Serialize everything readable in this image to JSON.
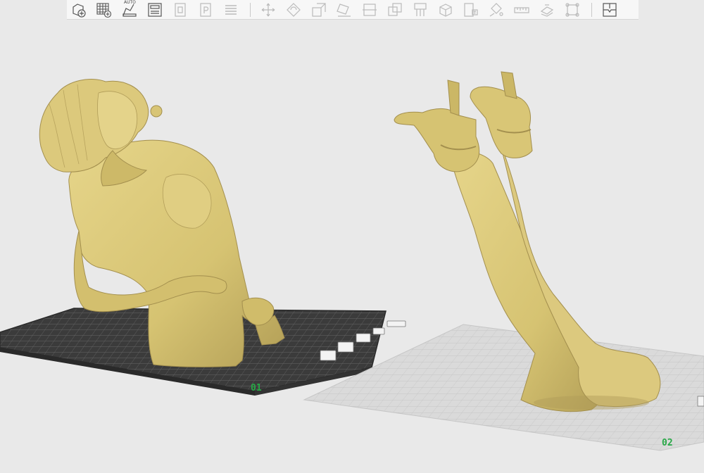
{
  "toolbar": {
    "buttons": [
      {
        "name": "add-plate-icon",
        "group": "plate"
      },
      {
        "name": "grid-layout-icon",
        "group": "plate"
      },
      {
        "name": "auto-arrange-icon",
        "group": "plate",
        "label": "AUTO"
      },
      {
        "name": "plate-settings-icon",
        "group": "plate"
      },
      {
        "name": "orient-icon",
        "group": "plate-disabled"
      },
      {
        "name": "plate-p-icon",
        "group": "plate-disabled"
      },
      {
        "name": "layers-icon",
        "group": "plate-disabled"
      },
      {
        "name": "move-icon",
        "group": "edit"
      },
      {
        "name": "rotate-icon",
        "group": "edit"
      },
      {
        "name": "scale-icon",
        "group": "edit"
      },
      {
        "name": "lay-on-face-icon",
        "group": "edit"
      },
      {
        "name": "cut-icon",
        "group": "edit"
      },
      {
        "name": "boolean-icon",
        "group": "edit"
      },
      {
        "name": "supports-icon",
        "group": "edit"
      },
      {
        "name": "box-icon",
        "group": "edit"
      },
      {
        "name": "text-emboss-icon",
        "group": "edit"
      },
      {
        "name": "paint-icon",
        "group": "edit"
      },
      {
        "name": "measure-icon",
        "group": "edit"
      },
      {
        "name": "assembly-icon",
        "group": "edit"
      },
      {
        "name": "resize-frame-icon",
        "group": "edit"
      },
      {
        "name": "split-parts-icon",
        "group": "split"
      }
    ],
    "auto_label": "AUTO"
  },
  "plates": [
    {
      "id": "plate-01",
      "label": "01",
      "active": true
    },
    {
      "id": "plate-02",
      "label": "02",
      "active": false
    }
  ],
  "colors": {
    "model": "#d9c77a",
    "model_shade": "#a89550",
    "active_plate": "#3a3a3a",
    "inactive_plate": "#dcdcdc",
    "plate_label": "#27a846",
    "background": "#e9e9e9"
  }
}
